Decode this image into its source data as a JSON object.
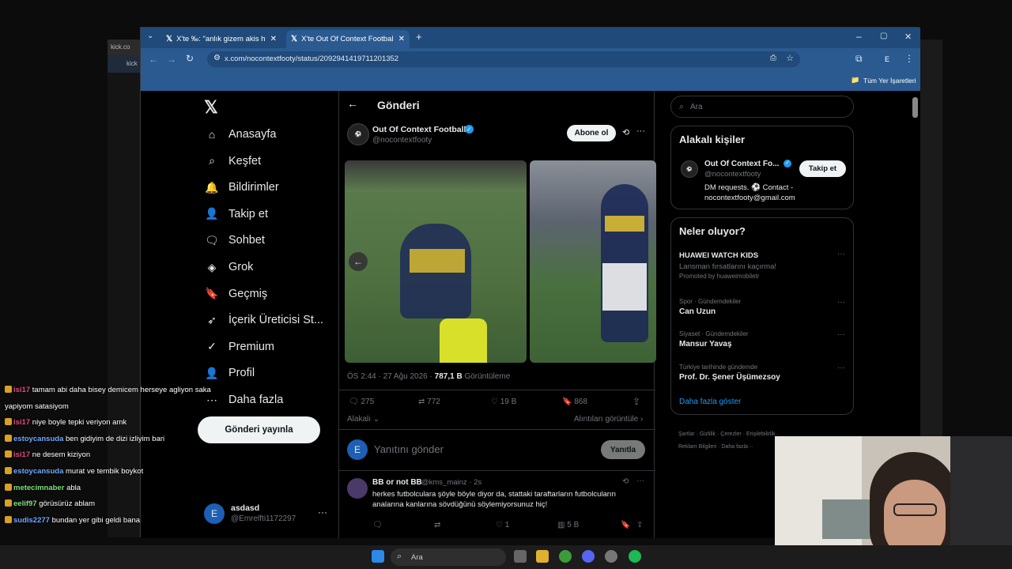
{
  "bg_window": {
    "tab_label": "kick.co",
    "addr_label": "kick"
  },
  "browser": {
    "tabs": [
      {
        "label": "X'te ‰: \"anlık gizem akis https:/",
        "active": false
      },
      {
        "label": "X'te Out Of Context Football: \"",
        "active": true
      }
    ],
    "url": "x.com/nocontextfooty/status/2092941419711201352",
    "profile_initial": "E",
    "bookmarks_label": "Tüm Yer İşaretleri"
  },
  "nav": {
    "items": [
      {
        "label": "Anasayfa",
        "icon": "home-icon"
      },
      {
        "label": "Keşfet",
        "icon": "search-icon"
      },
      {
        "label": "Bildirimler",
        "icon": "bell-icon"
      },
      {
        "label": "Takip et",
        "icon": "add-person-icon"
      },
      {
        "label": "Sohbet",
        "icon": "chat-icon"
      },
      {
        "label": "Grok",
        "icon": "grok-icon"
      },
      {
        "label": "Geçmiş",
        "icon": "bookmark-icon"
      },
      {
        "label": "İçerik Üreticisi St...",
        "icon": "rocket-icon"
      },
      {
        "label": "Premium",
        "icon": "verified-icon"
      },
      {
        "label": "Profil",
        "icon": "person-icon"
      },
      {
        "label": "Daha fazla",
        "icon": "more-circle-icon"
      }
    ],
    "post_button": "Gönderi yayınla",
    "account": {
      "name": "asdasd",
      "handle": "@Emrelfti1172297",
      "initial": "E"
    }
  },
  "post": {
    "header_title": "Gönderi",
    "author_name": "Out Of Context Football",
    "author_handle": "@nocontextfooty",
    "subscribe": "Abone ol",
    "time": "ÖS 2:44 · 27 Ağu 2026 ·",
    "views_count": "787,1 B",
    "views_label": "Görüntüleme",
    "stats": {
      "replies": "275",
      "reposts": "772",
      "likes": "19 B",
      "bookmarks": "868"
    },
    "relevant": "Alakalı",
    "quotes": "Alıntıları görüntüle",
    "reply_placeholder": "Yanıtını gönder",
    "reply_button": "Yanıtla",
    "reply_initial": "E"
  },
  "reply": {
    "name": "BB or not BB",
    "handle": "@kms_mainz · 2s",
    "text_line1": "herkes futbolculara şöyle böyle diyor da, stattaki taraftarların futbolcuların",
    "text_line2": "analarına kanlarına sövdüğünü söylemiyorsunuz hiç!",
    "likes": "1",
    "views": "5 B"
  },
  "right": {
    "search_placeholder": "Ara",
    "relevant_title": "Alakalı kişiler",
    "person_name": "Out Of Context Fo...",
    "person_handle": "@nocontextfooty",
    "follow": "Takip et",
    "bio_line1": "DM requests. ⚽ Contact -",
    "bio_line2": "nocontextfooty@gmail.com",
    "trends_title": "Neler oluyor?",
    "trends": [
      {
        "meta": "",
        "title": "HUAWEI WATCH KIDS",
        "sub": "Lansman fırsatlarını kaçırma!",
        "promo": "Promoted by huaweimobiletr"
      },
      {
        "meta": "Spor · Gündemdekiler",
        "title": "Can Uzun"
      },
      {
        "meta": "Siyaset · Gündemdekiler",
        "title": "Mansur Yavaş"
      },
      {
        "meta": "Türkiye tarihinde gündemde",
        "title": "Prof. Dr. Şener Üşümezsoy"
      }
    ],
    "show_more": "Daha fazla göster",
    "footer1": "Şartlar · Gizlilik · Çerezler · Erişilebilirlik ·",
    "footer2": "Reklam Bilgileri · Daha fazla···"
  },
  "chat": [
    {
      "user": "isi17",
      "color": "#e04a7f",
      "text": "tamam abi daha bisey demicem herseye agliyon saka"
    },
    {
      "user": "",
      "color": "#fff",
      "text": "yapiyom satasiyom"
    },
    {
      "user": "isi17",
      "color": "#e04a7f",
      "text": "niye boyle tepki veriyon amk"
    },
    {
      "user": "estoycansuda",
      "color": "#6fa8ff",
      "text": "ben gidiyim de dizi izliyim bari"
    },
    {
      "user": "isi17",
      "color": "#e04a7f",
      "text": "ne desem kiziyon"
    },
    {
      "user": "estoycansuda",
      "color": "#6fa8ff",
      "text": "murat ve tembik boykot"
    },
    {
      "user": "metecimnaber",
      "color": "#7ee07e",
      "text": "abla"
    },
    {
      "user": "eelif97",
      "color": "#7ee07e",
      "text": "görüsürüz ablam"
    },
    {
      "user": "sudis2277",
      "color": "#6fa8ff",
      "text": "bundan yer gibi geldi bana"
    }
  ],
  "taskbar": {
    "search_placeholder": "Ara"
  },
  "colors": {
    "x_blue": "#1d9bf0",
    "tab_bar": "#1f4a7a",
    "verified": "#1d9bf0"
  }
}
